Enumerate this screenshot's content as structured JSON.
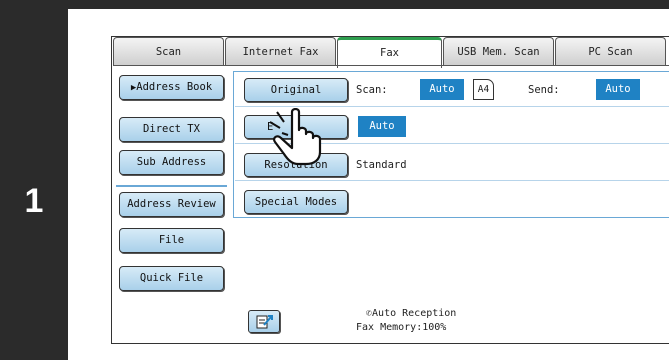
{
  "step": {
    "number": "1"
  },
  "tabs": [
    {
      "label": "Scan",
      "active": false
    },
    {
      "label": "Internet Fax",
      "active": false
    },
    {
      "label": "Fax",
      "active": true
    },
    {
      "label": "USB Mem. Scan",
      "active": false
    },
    {
      "label": "PC Scan",
      "active": false
    }
  ],
  "sidebar": {
    "address_book": "Address Book",
    "direct_tx": "Direct TX",
    "sub_address": "Sub Address",
    "address_review": "Address Review",
    "file": "File",
    "quick_file": "Quick File"
  },
  "options": {
    "original": "Original",
    "exposure_visible": "E",
    "resolution": "Resolution",
    "special_modes": "Special Modes"
  },
  "settings": {
    "scan_label": "Scan:",
    "scan_value": "Auto",
    "paper_size": "A4",
    "send_label": "Send:",
    "send_value": "Auto",
    "exposure_value": "Auto",
    "resolution_value": "Standard"
  },
  "status": {
    "reception": "Auto Reception",
    "memory": "Fax Memory:100%"
  },
  "colors": {
    "accent_blue": "#1f82c4",
    "button_blue": "#a9d0ea",
    "active_tab": "#2e9e4f",
    "step_bar": "#2b2b2b"
  },
  "icons": {
    "step_bar": "step-indicator",
    "pointer": "pointing-hand-icon",
    "fax_preview": "fax-preview-icon",
    "reception": "phone-receiver-icon"
  }
}
